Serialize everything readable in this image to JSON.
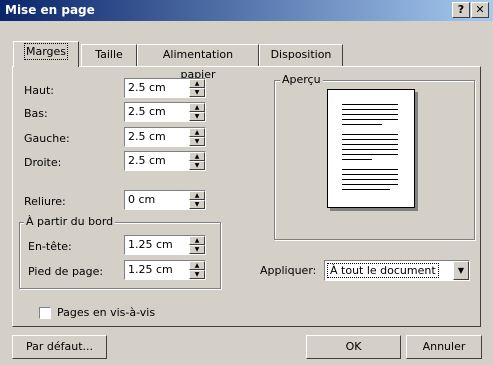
{
  "window": {
    "title": "Mise en page",
    "help_glyph": "?",
    "close_glyph": "✕"
  },
  "tabs": [
    {
      "label": "Marges",
      "active": true
    },
    {
      "label": "Taille"
    },
    {
      "label": "Alimentation papier"
    },
    {
      "label": "Disposition"
    }
  ],
  "margins": {
    "haut": {
      "label": "Haut:",
      "value": "2.5 cm"
    },
    "bas": {
      "label": "Bas:",
      "value": "2.5 cm"
    },
    "gauche": {
      "label": "Gauche:",
      "value": "2.5 cm"
    },
    "droite": {
      "label": "Droite:",
      "value": "2.5 cm"
    },
    "reliure": {
      "label": "Reliure:",
      "value": "0 cm"
    }
  },
  "from_edge": {
    "group_label": "À partir du bord",
    "entete": {
      "label": "En-tête:",
      "value": "1.25 cm"
    },
    "pied": {
      "label": "Pied de page:",
      "value": "1.25 cm"
    }
  },
  "preview": {
    "group_label": "Aperçu"
  },
  "apply": {
    "label": "Appliquer:",
    "value": "À tout le document"
  },
  "mirror": {
    "label": "Pages en vis-à-vis",
    "checked": false
  },
  "buttons": {
    "default": "Par défaut...",
    "ok": "OK",
    "cancel": "Annuler"
  }
}
